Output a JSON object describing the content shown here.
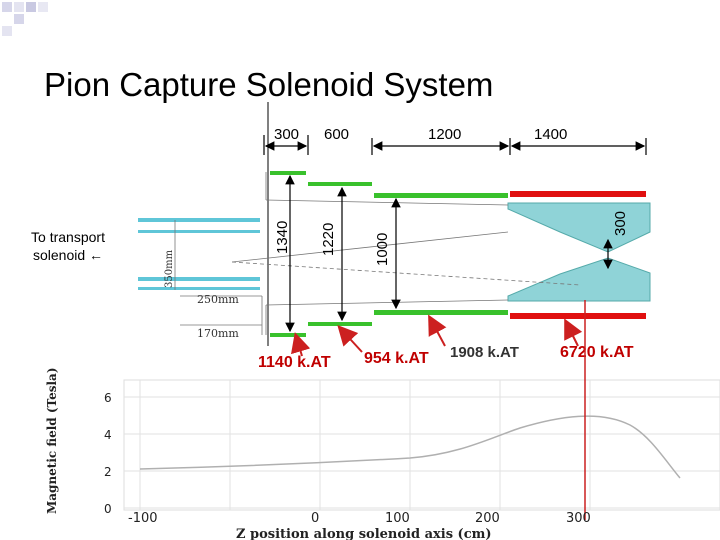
{
  "title": "Pion Capture Solenoid System",
  "dimensions": {
    "top": [
      "300",
      "600",
      "1200",
      "1400"
    ],
    "vertical": [
      "1340",
      "1220",
      "1000",
      "300"
    ],
    "sketch": [
      "350mm",
      "250mm",
      "170mm"
    ]
  },
  "transport_label": "To transport solenoid ←",
  "currents": [
    "1140 k.AT",
    "954 k.AT",
    "1908 k.AT",
    "6720 k.AT"
  ],
  "plot": {
    "ylabel": "Magnetic field (Tesla)",
    "xlabel": "Z position along solenoid axis (cm)",
    "yticks": [
      "0",
      "2",
      "4",
      "6"
    ],
    "xticks": [
      "-100",
      "0",
      "100",
      "200",
      "300"
    ]
  },
  "colors": {
    "green": "#39c12c",
    "red": "#e01010",
    "cyan": "#8fd3d7",
    "arrow_red": "#cc2020",
    "curve": "#b0b0b0"
  }
}
